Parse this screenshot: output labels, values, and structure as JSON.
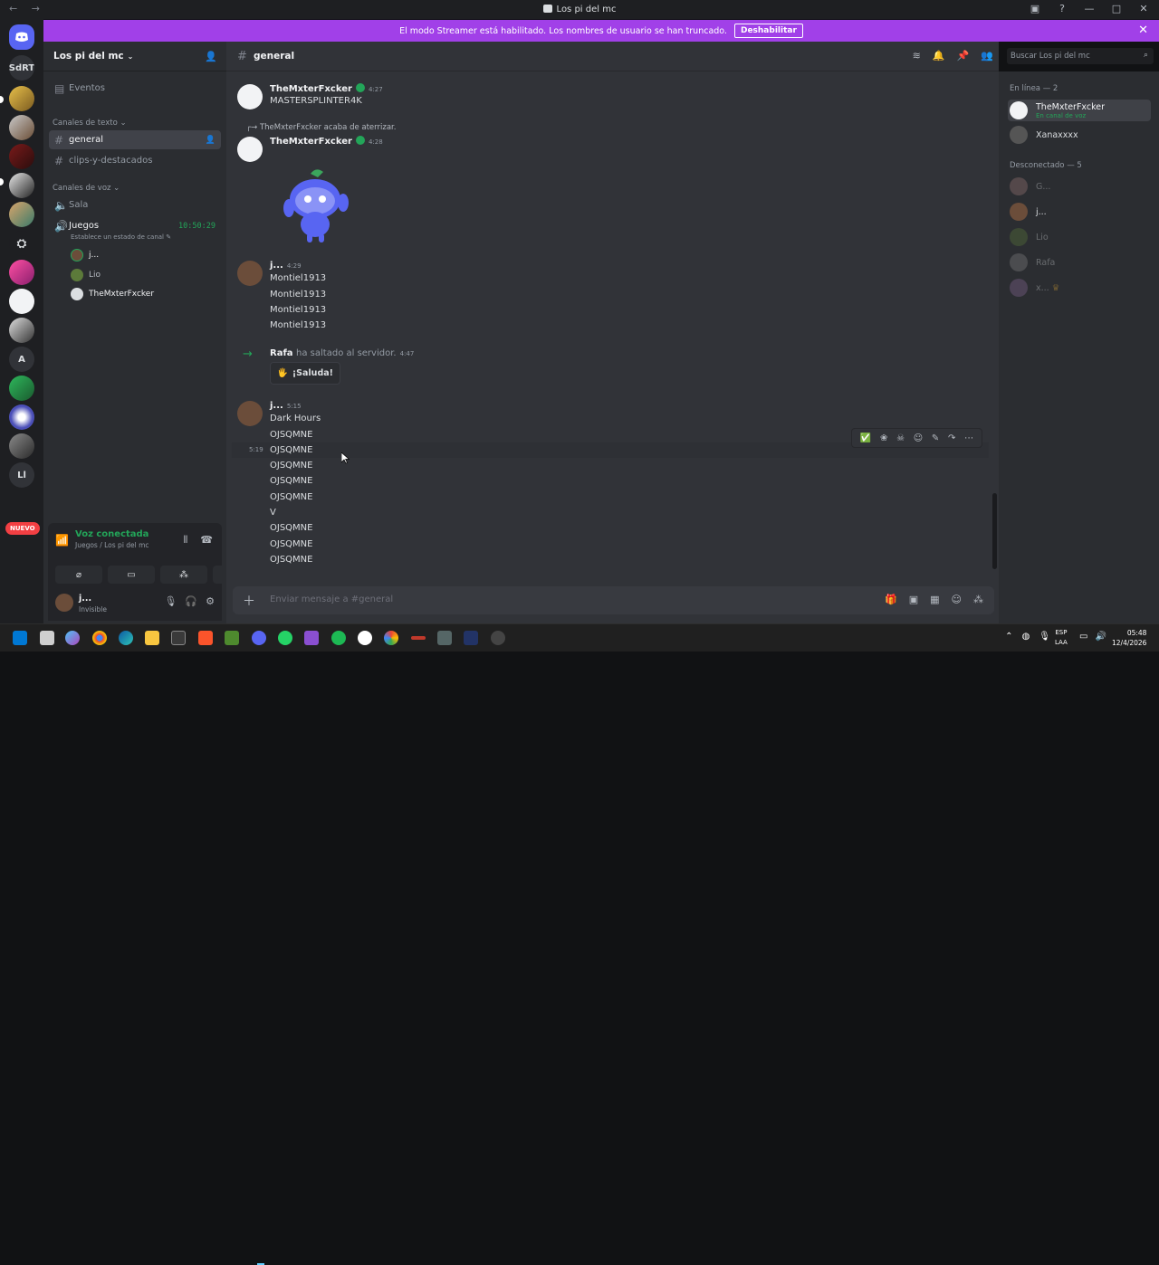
{
  "window": {
    "title": "Los pi del mc",
    "controls": [
      "□",
      "?",
      "—",
      "□",
      "✕"
    ]
  },
  "banner": {
    "text": "El modo Streamer está habilitado. Los nombres de usuario se han truncado.",
    "button": "Deshabilitar"
  },
  "rail": {
    "servers": [
      {
        "label": "SdRT"
      },
      {
        "label": "A"
      },
      {
        "label": "Ll"
      }
    ],
    "new_badge": "NUEVO"
  },
  "sidebar": {
    "guild_name": "Los pi del mc",
    "events": "Eventos",
    "text_category": "Canales de texto",
    "text_channels": [
      {
        "name": "general"
      },
      {
        "name": "clips-y-destacados"
      }
    ],
    "voice_category": "Canales de voz",
    "voice_channels": [
      {
        "name": "Sala"
      },
      {
        "name": "Juegos",
        "timer": "10:50:29",
        "status": "Establece un estado de canal"
      }
    ],
    "voice_users": [
      "j...",
      "Lio",
      "TheMxterFxcker"
    ]
  },
  "voice_panel": {
    "status": "Voz conectada",
    "location": "Juegos / Los pi del mc"
  },
  "user_bar": {
    "name": "j...",
    "status": "Invisible"
  },
  "channel": {
    "name": "general",
    "search_placeholder": "Buscar Los pi del mc"
  },
  "messages": {
    "m1": {
      "author": "TheMxterFxcker",
      "time": "4:27",
      "text": "MASTERSPLINTER4K"
    },
    "m2": {
      "reply": "TheMxterFxcker acaba de aterrizar.",
      "author": "TheMxterFxcker",
      "time": "4:28"
    },
    "m3": {
      "author": "j...",
      "time": "4:29",
      "lines": [
        "Montiel1913",
        "Montiel1913",
        "Montiel1913",
        "Montiel1913"
      ]
    },
    "m4": {
      "author": "Rafa",
      "action": "ha saltado al servidor.",
      "time": "4:47",
      "button": "¡Saluda!"
    },
    "m5": {
      "author": "j...",
      "time": "5:15",
      "lines": [
        "Dark Hours",
        "OJSQMNE",
        "OJSQMNE",
        "OJSQMNE",
        "OJSQMNE",
        "OJSQMNE",
        "V",
        "OJSQMNE",
        "OJSQMNE",
        "OJSQMNE"
      ],
      "hover_time": "5:19"
    }
  },
  "composer": {
    "placeholder": "Enviar mensaje a #general"
  },
  "members": {
    "online_header": "En línea — 2",
    "online": [
      {
        "name": "TheMxterFxcker",
        "sub": "En canal de voz"
      },
      {
        "name": "Xanaxxxx"
      }
    ],
    "offline_header": "Desconectado — 5",
    "offline": [
      {
        "name": "G..."
      },
      {
        "name": "j..."
      },
      {
        "name": "Lio"
      },
      {
        "name": "Rafa"
      },
      {
        "name": "x..."
      }
    ]
  },
  "taskbar": {
    "lang1": "ESP",
    "lang2": "LAA",
    "time": "05:48",
    "date": "12/4/2026"
  },
  "colors": {
    "banner": "#a140e8",
    "accent_green": "#23a559",
    "background": "#313338"
  }
}
